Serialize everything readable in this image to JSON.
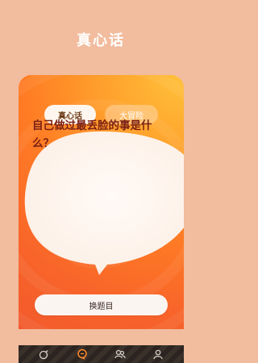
{
  "header": {
    "title": "真心话"
  },
  "tabs": [
    {
      "label": "真心话",
      "active": true
    },
    {
      "label": "大冒险",
      "active": false
    }
  ],
  "question": {
    "text": "自己做过最丢脸的事是什么？"
  },
  "actions": {
    "change_label": "换题目"
  },
  "bottom_nav": {
    "items": [
      {
        "icon": "bomb-icon",
        "active": false
      },
      {
        "icon": "chat-bubble-icon",
        "active": true
      },
      {
        "icon": "users-icon",
        "active": false
      },
      {
        "icon": "profile-icon",
        "active": false
      }
    ]
  },
  "colors": {
    "background": "#f2bc9e",
    "card_orange": "#f8642a",
    "card_yellow": "#ffc13a",
    "accent": "#ff8a2a",
    "question_text": "#7a1f14",
    "nav_bg": "#2c2420"
  }
}
